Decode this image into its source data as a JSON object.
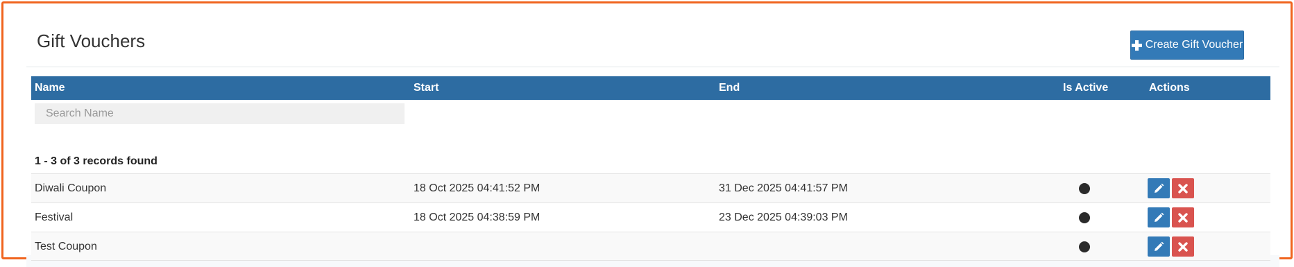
{
  "page": {
    "title": "Gift Vouchers",
    "create_button_label": "Create Gift Voucher",
    "create_button_icon": "plus-icon"
  },
  "table": {
    "columns": [
      "Name",
      "Start",
      "End",
      "Is Active",
      "Actions"
    ],
    "search": {
      "placeholder": "Search Name",
      "value": ""
    },
    "records_found": "1 - 3 of 3 records found",
    "rows": [
      {
        "name": "Diwali Coupon",
        "start": "18 Oct 2025 04:41:52 PM",
        "end": "31 Dec 2025 04:41:57 PM",
        "is_active": true
      },
      {
        "name": "Festival",
        "start": "18 Oct 2025 04:38:59 PM",
        "end": "23 Dec 2025 04:39:03 PM",
        "is_active": true
      },
      {
        "name": "Test Coupon",
        "start": "",
        "end": "",
        "is_active": true
      }
    ],
    "row_actions": [
      "edit-pencil-icon",
      "delete-x-icon"
    ]
  },
  "colors": {
    "header_bg": "#2d6ca2",
    "primary_button": "#337ab7",
    "danger_button": "#d9534f",
    "frame_border": "#f0641e"
  }
}
